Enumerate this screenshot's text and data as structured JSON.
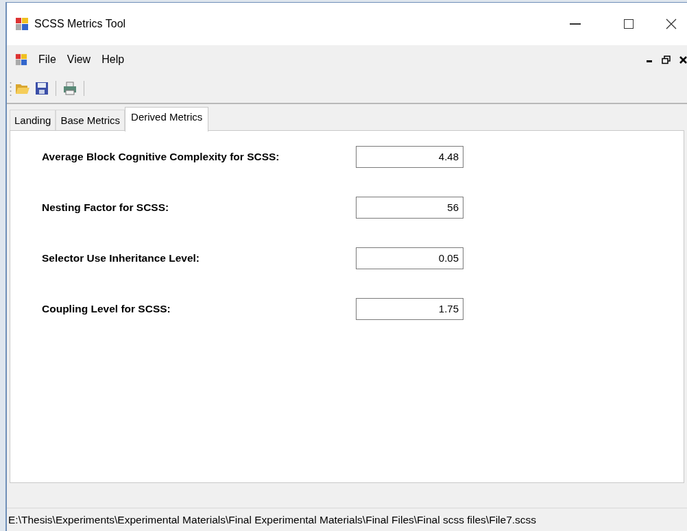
{
  "window": {
    "title": "SCSS Metrics Tool"
  },
  "menu": [
    "File",
    "View",
    "Help"
  ],
  "tabs": [
    {
      "label": "Landing",
      "selected": false
    },
    {
      "label": "Base Metrics",
      "selected": false
    },
    {
      "label": "Derived Metrics",
      "selected": true
    }
  ],
  "metrics": [
    {
      "label": "Average Block Cognitive Complexity for SCSS:",
      "value": "4.48"
    },
    {
      "label": "Nesting Factor for SCSS:",
      "value": "56"
    },
    {
      "label": "Selector Use Inheritance Level:",
      "value": "0.05"
    },
    {
      "label": "Coupling Level for SCSS:",
      "value": "1.75"
    }
  ],
  "status_bar": "E:\\Thesis\\Experiments\\Experimental Materials\\Final Experimental Materials\\Final Files\\Final scss files\\File7.scss"
}
